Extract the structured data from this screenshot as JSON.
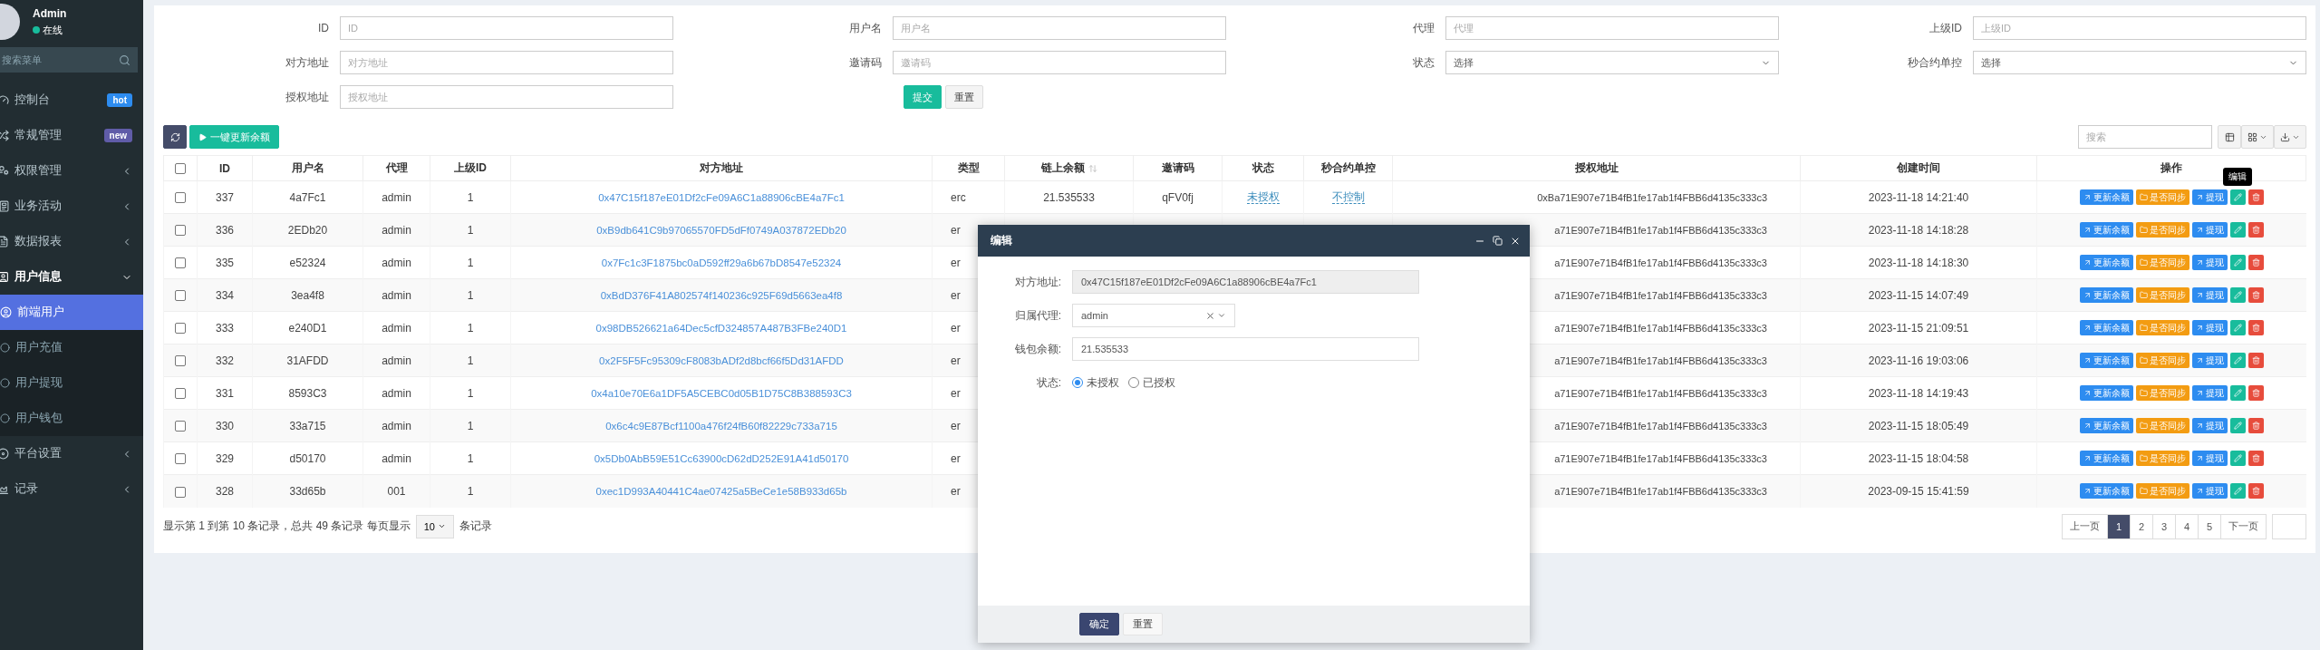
{
  "sidebar": {
    "user": {
      "name": "Admin",
      "status": "在线"
    },
    "search": {
      "placeholder": "搜索菜单"
    },
    "items": [
      {
        "label": "控制台",
        "kind": "link",
        "badge": {
          "text": "hot",
          "color": "#2d8cf0"
        }
      },
      {
        "label": "常规管理",
        "kind": "link",
        "badge": {
          "text": "new",
          "color": "#605ca8"
        }
      },
      {
        "label": "权限管理",
        "kind": "group",
        "expanded": false
      },
      {
        "label": "业务活动",
        "kind": "group",
        "expanded": false
      },
      {
        "label": "数据报表",
        "kind": "group",
        "expanded": false
      },
      {
        "label": "用户信息",
        "kind": "group",
        "expanded": true,
        "children": [
          {
            "label": "前端用户",
            "selected": true
          },
          {
            "label": "用户充值",
            "selected": false
          },
          {
            "label": "用户提现",
            "selected": false
          },
          {
            "label": "用户钱包",
            "selected": false
          }
        ]
      },
      {
        "label": "平台设置",
        "kind": "group",
        "expanded": false
      },
      {
        "label": "记录",
        "kind": "group",
        "expanded": false
      }
    ]
  },
  "filters": [
    {
      "label": "ID",
      "kind": "input",
      "placeholder": "ID"
    },
    {
      "label": "用户名",
      "kind": "input",
      "placeholder": "用户名"
    },
    {
      "label": "代理",
      "kind": "input",
      "placeholder": "代理"
    },
    {
      "label": "上级ID",
      "kind": "input",
      "placeholder": "上级ID"
    },
    {
      "label": "对方地址",
      "kind": "input",
      "placeholder": "对方地址"
    },
    {
      "label": "邀请码",
      "kind": "input",
      "placeholder": "邀请码"
    },
    {
      "label": "状态",
      "kind": "select",
      "value": "选择"
    },
    {
      "label": "秒合约单控",
      "kind": "select",
      "value": "选择"
    },
    {
      "label": "授权地址",
      "kind": "input",
      "placeholder": "授权地址"
    }
  ],
  "filter_buttons": [
    {
      "label": "提交",
      "kind": "primary"
    },
    {
      "label": "重置",
      "kind": "default"
    }
  ],
  "toolbar": {
    "update_button": "一键更新余额",
    "search": {
      "placeholder": "搜索"
    }
  },
  "table": {
    "select_all": {
      "checked": false
    },
    "columns": [
      {
        "label": "ID",
        "sortable": false
      },
      {
        "label": "用户名",
        "sortable": false
      },
      {
        "label": "代理",
        "sortable": false
      },
      {
        "label": "上级ID",
        "sortable": false
      },
      {
        "label": "对方地址",
        "sortable": false
      },
      {
        "label": "类型",
        "sortable": false
      },
      {
        "label": "链上余额",
        "sortable": true
      },
      {
        "label": "邀请码",
        "sortable": false
      },
      {
        "label": "状态",
        "sortable": false
      },
      {
        "label": "秒合约单控",
        "sortable": false
      },
      {
        "label": "授权地址",
        "sortable": false
      },
      {
        "label": "创建时间",
        "sortable": false
      },
      {
        "label": "操作",
        "sortable": false
      }
    ],
    "rows": [
      {
        "checked": false,
        "id": "337",
        "username": "4a7Fc1",
        "agent": "admin",
        "parent_id": "1",
        "address": "0x47C15f187eE01Df2cFe09A6C1a88906cBE4a7Fc1",
        "type": "erc",
        "balance": "21.535533",
        "invite_code": "qFV0fj",
        "status": "未授权",
        "control": "不控制",
        "auth_address": "0xBa71E907e71B4fB1fe17ab1f4FBB6d4135c333c3",
        "created": "2023-11-18 14:21:40",
        "actions": [
          "更新余额",
          "是否同步",
          "提现"
        ],
        "tooltip": "编辑"
      },
      {
        "checked": false,
        "id": "336",
        "username": "2EDb20",
        "agent": "admin",
        "parent_id": "1",
        "address": "0xB9db641C9b97065570FD5dFf0749A037872EDb20",
        "type": "er",
        "auth_address": "a71E907e71B4fB1fe17ab1f4FBB6d4135c333c3",
        "created": "2023-11-18 14:18:28",
        "actions": [
          "更新余额",
          "是否同步",
          "提现"
        ]
      },
      {
        "checked": false,
        "id": "335",
        "username": "e52324",
        "agent": "admin",
        "parent_id": "1",
        "address": "0x7Fc1c3F1875bc0aD592ff29a6b67bD8547e52324",
        "type": "er",
        "auth_address": "a71E907e71B4fB1fe17ab1f4FBB6d4135c333c3",
        "created": "2023-11-18 14:18:30",
        "actions": [
          "更新余额",
          "是否同步",
          "提现"
        ]
      },
      {
        "checked": false,
        "id": "334",
        "username": "3ea4f8",
        "agent": "admin",
        "parent_id": "1",
        "address": "0xBdD376F41A802574f140236c925F69d5663ea4f8",
        "type": "er",
        "auth_address": "a71E907e71B4fB1fe17ab1f4FBB6d4135c333c3",
        "created": "2023-11-15 14:07:49",
        "actions": [
          "更新余额",
          "是否同步",
          "提现"
        ]
      },
      {
        "checked": false,
        "id": "333",
        "username": "e240D1",
        "agent": "admin",
        "parent_id": "1",
        "address": "0x98DB526621a64Dec5cfD324857A487B3FBe240D1",
        "type": "er",
        "auth_address": "a71E907e71B4fB1fe17ab1f4FBB6d4135c333c3",
        "created": "2023-11-15 21:09:51",
        "actions": [
          "更新余额",
          "是否同步",
          "提现"
        ]
      },
      {
        "checked": false,
        "id": "332",
        "username": "31AFDD",
        "agent": "admin",
        "parent_id": "1",
        "address": "0x2F5F5Fc95309cF8083bADf2d8bcf66f5Dd31AFDD",
        "type": "er",
        "auth_address": "a71E907e71B4fB1fe17ab1f4FBB6d4135c333c3",
        "created": "2023-11-16 19:03:06",
        "actions": [
          "更新余额",
          "是否同步",
          "提现"
        ]
      },
      {
        "checked": false,
        "id": "331",
        "username": "8593C3",
        "agent": "admin",
        "parent_id": "1",
        "address": "0x4a10e70E6a1DF5A5CEBC0d05B1D75C8B388593C3",
        "type": "er",
        "auth_address": "a71E907e71B4fB1fe17ab1f4FBB6d4135c333c3",
        "created": "2023-11-18 14:19:43",
        "actions": [
          "更新余额",
          "是否同步",
          "提现"
        ]
      },
      {
        "checked": false,
        "id": "330",
        "username": "33a715",
        "agent": "admin",
        "parent_id": "1",
        "address": "0x6c4c9E87Bcf1100a476f24fB60f82229c733a715",
        "type": "er",
        "auth_address": "a71E907e71B4fB1fe17ab1f4FBB6d4135c333c3",
        "created": "2023-11-15 18:05:49",
        "actions": [
          "更新余额",
          "是否同步",
          "提现"
        ]
      },
      {
        "checked": false,
        "id": "329",
        "username": "d50170",
        "agent": "admin",
        "parent_id": "1",
        "address": "0x5Db0AbB59E51Cc63900cD62dD252E91A41d50170",
        "type": "er",
        "auth_address": "a71E907e71B4fB1fe17ab1f4FBB6d4135c333c3",
        "created": "2023-11-15 18:04:58",
        "actions": [
          "更新余额",
          "是否同步",
          "提现"
        ]
      },
      {
        "checked": false,
        "id": "328",
        "username": "33d65b",
        "agent": "001",
        "parent_id": "1",
        "address": "0xec1D993A40441C4ae07425a5BeCe1e58B933d65b",
        "type": "er",
        "auth_address": "a71E907e71B4fB1fe17ab1f4FBB6d4135c333c3",
        "created": "2023-09-15 15:41:59",
        "actions": [
          "更新余额",
          "是否同步",
          "提现"
        ]
      }
    ]
  },
  "footer": {
    "summary": "显示第 1 到第 10 条记录，总共 49 条记录 每页显示",
    "page_size": "10",
    "suffix": "条记录"
  },
  "pagination": {
    "prev": "上一页",
    "pages": [
      {
        "label": "1",
        "selected": true
      },
      {
        "label": "2",
        "selected": false
      },
      {
        "label": "3",
        "selected": false
      },
      {
        "label": "4",
        "selected": false
      },
      {
        "label": "5",
        "selected": false
      }
    ],
    "next": "下一页"
  },
  "modal": {
    "title": "编辑",
    "fields": [
      {
        "label": "对方地址:",
        "kind": "readonly",
        "value": "0x47C15f187eE01Df2cFe09A6C1a88906cBE4a7Fc1"
      },
      {
        "label": "归属代理:",
        "kind": "select",
        "value": "admin"
      },
      {
        "label": "钱包余额:",
        "kind": "input",
        "value": "21.535533"
      },
      {
        "label": "状态:",
        "kind": "radio",
        "options": [
          {
            "label": "未授权",
            "selected": true
          },
          {
            "label": "已授权",
            "selected": false
          }
        ]
      }
    ],
    "buttons": [
      {
        "label": "确定",
        "kind": "primary"
      },
      {
        "label": "重置",
        "kind": "default"
      }
    ]
  }
}
